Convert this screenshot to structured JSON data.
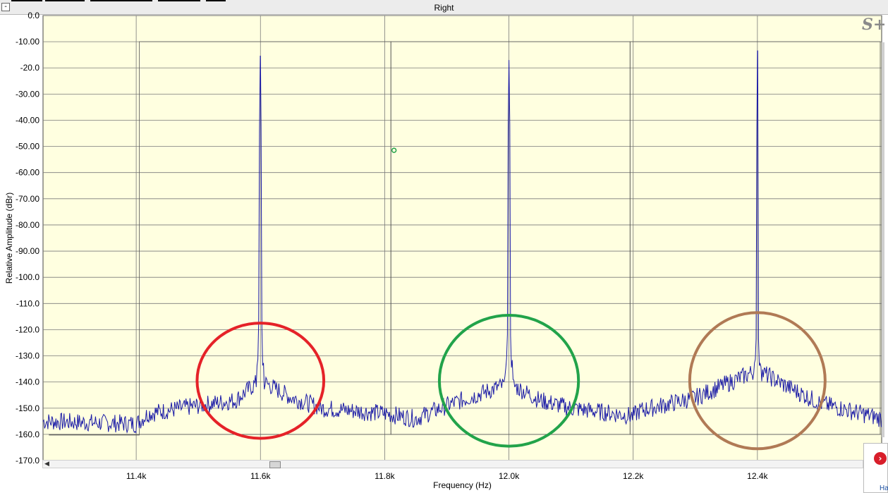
{
  "window": {
    "title": "Right",
    "collapse_label": "-"
  },
  "logo": {
    "text": "S+"
  },
  "corner_logo": {
    "glyph": "›",
    "text": "Ha"
  },
  "colors": {
    "plot_bg": "#ffffe0",
    "grid": "#7a7a7a",
    "trace": "#1a1aa6",
    "circle_left": "#e52228",
    "circle_mid": "#22a34a",
    "circle_right": "#b07a55"
  },
  "chart_data": {
    "type": "line",
    "xlabel": "Frequency (Hz)",
    "ylabel": "Relative Amplitude (dBr)",
    "xlim": [
      11250,
      12600
    ],
    "ylim": [
      -170,
      0
    ],
    "grid": true,
    "x_ticks": [
      11400,
      11600,
      11800,
      12000,
      12200,
      12400
    ],
    "x_tick_labels": [
      "11.4k",
      "11.6k",
      "11.8k",
      "12.0k",
      "12.2k",
      "12.4k"
    ],
    "y_ticks": [
      0,
      -10,
      -20,
      -30,
      -40,
      -50,
      -60,
      -70,
      -80,
      -90,
      -100,
      -110,
      -120,
      -130,
      -140,
      -150,
      -160,
      -170
    ],
    "y_tick_labels": [
      "0.0",
      "-10.00",
      "-20.0",
      "-30.00",
      "-40.00",
      "-50.00",
      "-60.00",
      "-70.00",
      "-80.00",
      "-90.00",
      "-100.0",
      "-110.0",
      "-120.0",
      "-130.0",
      "-140.0",
      "-150.0",
      "-160.0",
      "-170.0"
    ],
    "peaks": [
      {
        "freq": 11600,
        "level": -15.5
      },
      {
        "freq": 12000,
        "level": -17
      },
      {
        "freq": 12400,
        "level": -13.5
      }
    ],
    "noise_floor_points": [
      [
        11250,
        -155
      ],
      [
        11400,
        -156
      ],
      [
        11420,
        -152
      ],
      [
        11500,
        -149
      ],
      [
        11560,
        -147
      ],
      [
        11595,
        -140
      ],
      [
        11605,
        -140
      ],
      [
        11650,
        -146
      ],
      [
        11700,
        -150
      ],
      [
        11800,
        -152
      ],
      [
        11850,
        -154
      ],
      [
        11900,
        -149
      ],
      [
        11995,
        -141
      ],
      [
        12005,
        -141
      ],
      [
        12050,
        -147
      ],
      [
        12100,
        -150
      ],
      [
        12200,
        -153
      ],
      [
        12210,
        -151
      ],
      [
        12300,
        -146
      ],
      [
        12395,
        -136
      ],
      [
        12405,
        -136
      ],
      [
        12450,
        -142
      ],
      [
        12500,
        -148
      ],
      [
        12600,
        -154
      ]
    ],
    "circles": [
      {
        "center_freq": 11600,
        "center_level": -139.5,
        "half_width_freq": 102,
        "half_height_db": 22
      },
      {
        "center_freq": 12000,
        "center_level": -139.5,
        "half_width_freq": 112,
        "half_height_db": 25
      },
      {
        "center_freq": 12400,
        "center_level": -139.5,
        "half_width_freq": 109,
        "half_height_db": 26
      }
    ],
    "marker": {
      "freq": 11815,
      "level": -51.5
    }
  }
}
